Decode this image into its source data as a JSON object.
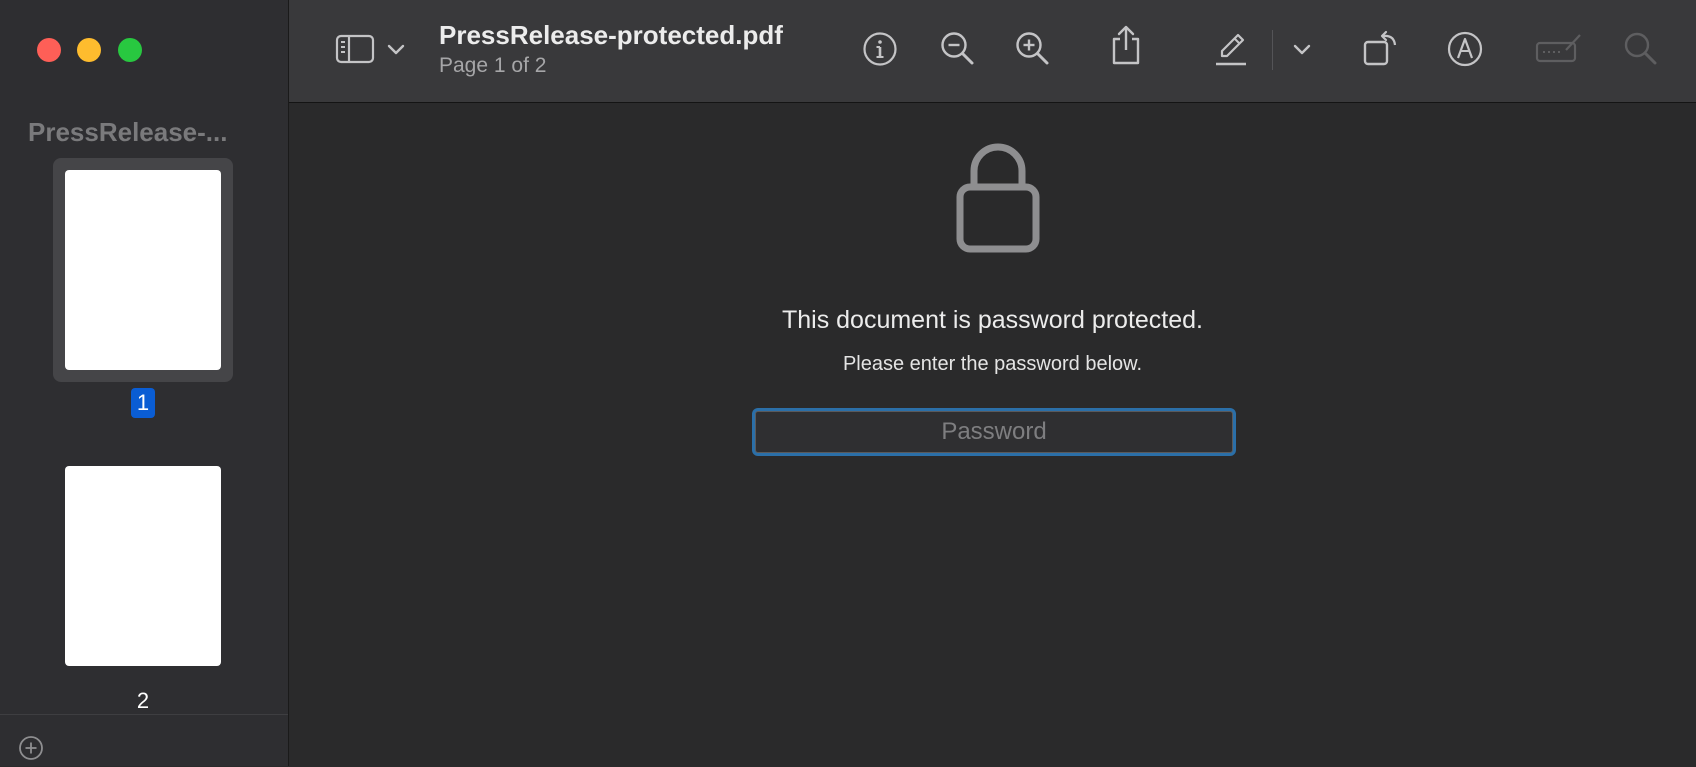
{
  "window": {
    "title": "PressRelease-protected.pdf",
    "subtitle": "Page 1 of 2"
  },
  "sidebar": {
    "title": "PressRelease-...",
    "pages": [
      {
        "number": "1",
        "selected": true
      },
      {
        "number": "2",
        "selected": false
      }
    ]
  },
  "toolbar": {
    "icons": [
      "sidebar-toggle-icon",
      "chevron-down-icon",
      "info-icon",
      "zoom-out-icon",
      "zoom-in-icon",
      "share-icon",
      "highlight-pen-icon",
      "chevron-down-icon",
      "rotate-icon",
      "markup-icon",
      "form-fill-icon",
      "search-icon"
    ]
  },
  "main": {
    "message_title": "This document is password protected.",
    "message_body": "Please enter the password below.",
    "password": {
      "value": "",
      "placeholder": "Password"
    }
  },
  "colors": {
    "accent": "#0a5dd4",
    "focus_ring": "#2b6fa8",
    "close": "#fe5f57",
    "minimize": "#febc2e",
    "zoom": "#28c840"
  }
}
